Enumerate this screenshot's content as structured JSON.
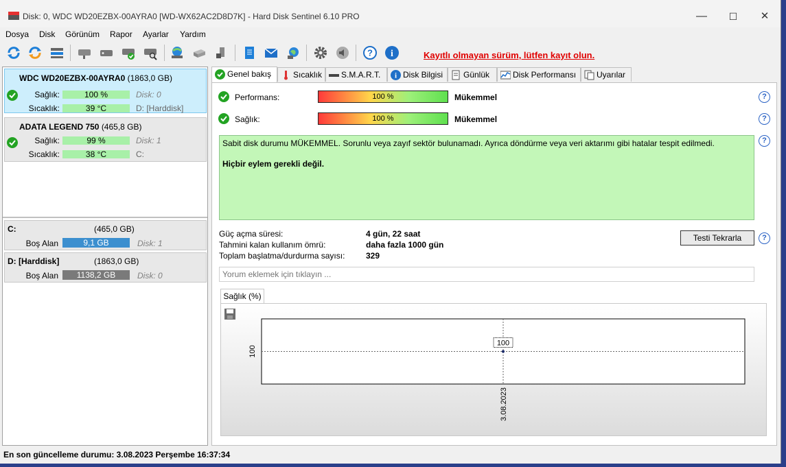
{
  "window": {
    "title": "Disk: 0, WDC WD20EZBX-00AYRA0 [WD-WX62AC2D8D7K]  -  Hard Disk Sentinel 6.10 PRO",
    "minimize": "—",
    "maximize": "☐",
    "close": "✕"
  },
  "menu": [
    "Dosya",
    "Disk",
    "Görünüm",
    "Rapor",
    "Ayarlar",
    "Yardım"
  ],
  "toolbar": {
    "register_notice": "Kayıtlı olmayan sürüm, lütfen kayıt olun."
  },
  "disks": [
    {
      "name": "WDC WD20EZBX-00AYRA0",
      "size": "(1863,0 GB)",
      "health_label": "Sağlık:",
      "health_value": "100 %",
      "health_side": "Disk: 0",
      "temp_label": "Sıcaklık:",
      "temp_value": "39 °C",
      "temp_side": "D: [Harddisk]"
    },
    {
      "name": "ADATA LEGEND 750",
      "size": "(465,8 GB)",
      "health_label": "Sağlık:",
      "health_value": "99 %",
      "health_side": "Disk: 1",
      "temp_label": "Sıcaklık:",
      "temp_value": "38 °C",
      "temp_side": "C:"
    }
  ],
  "partitions": [
    {
      "name": "C:",
      "size": "(465,0 GB)",
      "free_label": "Boş Alan",
      "free_value": "9,1 GB",
      "disk": "Disk: 1"
    },
    {
      "name": "D: [Harddisk]",
      "size": "(1863,0 GB)",
      "free_label": "Boş Alan",
      "free_value": "1138,2 GB",
      "disk": "Disk: 0"
    }
  ],
  "tabs": [
    "Genel bakış",
    "Sıcaklık",
    "S.M.A.R.T.",
    "Disk Bilgisi",
    "Günlük",
    "Disk Performansı",
    "Uyarılar"
  ],
  "overview": {
    "performance_label": "Performans:",
    "performance_value": "100 %",
    "performance_rating": "Mükemmel",
    "health_label": "Sağlık:",
    "health_value": "100 %",
    "health_rating": "Mükemmel",
    "status_text": "Sabit disk durumu MÜKEMMEL. Sorunlu veya zayıf sektör bulunamadı. Ayrıca döndürme veya veri aktarımı gibi hatalar tespit edilmedi.",
    "action_text": "Hiçbir eylem gerekli değil.",
    "power_on_label": "Güç açma süresi:",
    "power_on_value": "4 gün, 22 saat",
    "lifetime_label": "Tahmini kalan kullanım ömrü:",
    "lifetime_value": "daha fazla 1000 gün",
    "startstop_label": "Toplam başlatma/durdurma sayısı:",
    "startstop_value": "329",
    "retest_button": "Testi Tekrarla",
    "comment_placeholder": "Yorum eklemek için tıklayın ..."
  },
  "chart_data": {
    "type": "line",
    "tab_label": "Sağlık (%)",
    "x": [
      "3.08.2023"
    ],
    "series": [
      {
        "values": [
          100
        ]
      }
    ],
    "ytick": "100",
    "data_label": "100"
  },
  "statusbar": {
    "text": "En son güncelleme durumu: 3.08.2023 Perşembe 16:37:34"
  },
  "colors": {
    "selected_card": "#cdeefc",
    "health_bar": "#a8f0a8",
    "free_bar": "#3c8fcf",
    "status_box": "#c3f7b8",
    "register_notice": "#e00000"
  }
}
